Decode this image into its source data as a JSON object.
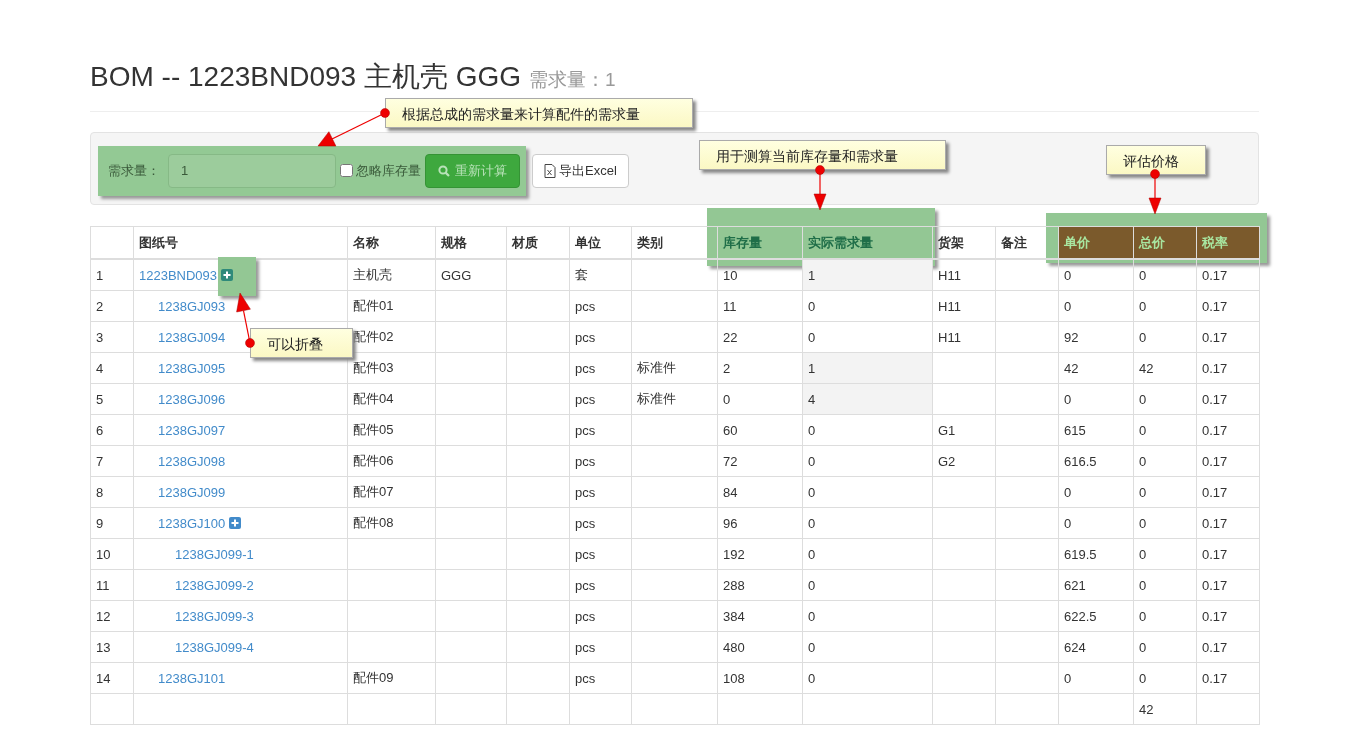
{
  "title": "BOM -- 1223BND093 主机壳 GGG",
  "subtitle": "需求量：1",
  "toolbar": {
    "quantity_label": "需求量：",
    "quantity_value": "1",
    "ignore_stock": {
      "label": "忽略库存量",
      "checked": false
    },
    "recalc_button": "重新计算",
    "export_button": "导出Excel"
  },
  "columns": [
    {
      "label": "图纸号"
    },
    {
      "label": "名称"
    },
    {
      "label": "规格"
    },
    {
      "label": "材质"
    },
    {
      "label": "单位"
    },
    {
      "label": "类别"
    },
    {
      "label": "库存量",
      "kind": "stock"
    },
    {
      "label": "实际需求量",
      "kind": "stock"
    },
    {
      "label": "货架"
    },
    {
      "label": "备注"
    },
    {
      "label": "单价",
      "kind": "price"
    },
    {
      "label": "总价",
      "kind": "price"
    },
    {
      "label": "税率",
      "kind": "price"
    }
  ],
  "rows": [
    {
      "no": "1",
      "drawing_no": "1223BND093",
      "name": "主机壳",
      "spec": "GGG",
      "unit": "套",
      "stock": "10",
      "demand": "1",
      "demand_highlight": true,
      "shelf": "H11",
      "unit_price": "0",
      "total": "0",
      "tax_rate": "0.17",
      "children": [
        {
          "no": "2",
          "drawing_no": "1238GJ093",
          "name": "配件01",
          "unit": "pcs",
          "stock": "11",
          "demand": "0",
          "demand_highlight": false,
          "shelf": "H11",
          "unit_price": "0",
          "total": "0",
          "tax_rate": "0.17"
        },
        {
          "no": "3",
          "drawing_no": "1238GJ094",
          "name": "配件02",
          "unit": "pcs",
          "stock": "22",
          "demand": "0",
          "demand_highlight": false,
          "shelf": "H11",
          "unit_price": "92",
          "total": "0",
          "tax_rate": "0.17"
        },
        {
          "no": "4",
          "drawing_no": "1238GJ095",
          "name": "配件03",
          "unit": "pcs",
          "category": "标准件",
          "stock": "2",
          "demand": "1",
          "demand_highlight": true,
          "unit_price": "42",
          "total": "42",
          "tax_rate": "0.17"
        },
        {
          "no": "5",
          "drawing_no": "1238GJ096",
          "name": "配件04",
          "unit": "pcs",
          "category": "标准件",
          "stock": "0",
          "demand": "4",
          "demand_highlight": true,
          "unit_price": "0",
          "total": "0",
          "tax_rate": "0.17"
        },
        {
          "no": "6",
          "drawing_no": "1238GJ097",
          "name": "配件05",
          "unit": "pcs",
          "stock": "60",
          "demand": "0",
          "demand_highlight": false,
          "shelf": "G1",
          "unit_price": "615",
          "total": "0",
          "tax_rate": "0.17"
        },
        {
          "no": "7",
          "drawing_no": "1238GJ098",
          "name": "配件06",
          "unit": "pcs",
          "stock": "72",
          "demand": "0",
          "demand_highlight": false,
          "shelf": "G2",
          "unit_price": "616.5",
          "total": "0",
          "tax_rate": "0.17"
        },
        {
          "no": "8",
          "drawing_no": "1238GJ099",
          "name": "配件07",
          "unit": "pcs",
          "stock": "84",
          "demand": "0",
          "demand_highlight": false,
          "unit_price": "0",
          "total": "0",
          "tax_rate": "0.17"
        },
        {
          "no": "9",
          "drawing_no": "1238GJ100",
          "name": "配件08",
          "unit": "pcs",
          "stock": "96",
          "demand": "0",
          "demand_highlight": false,
          "unit_price": "0",
          "total": "0",
          "tax_rate": "0.17",
          "children": [
            {
              "no": "10",
              "drawing_no": "1238GJ099-1",
              "unit": "pcs",
              "stock": "192",
              "demand": "0",
              "demand_highlight": false,
              "unit_price": "619.5",
              "total": "0",
              "tax_rate": "0.17"
            },
            {
              "no": "11",
              "drawing_no": "1238GJ099-2",
              "unit": "pcs",
              "stock": "288",
              "demand": "0",
              "demand_highlight": false,
              "unit_price": "621",
              "total": "0",
              "tax_rate": "0.17"
            },
            {
              "no": "12",
              "drawing_no": "1238GJ099-3",
              "unit": "pcs",
              "stock": "384",
              "demand": "0",
              "demand_highlight": false,
              "unit_price": "622.5",
              "total": "0",
              "tax_rate": "0.17"
            },
            {
              "no": "13",
              "drawing_no": "1238GJ099-4",
              "unit": "pcs",
              "stock": "480",
              "demand": "0",
              "demand_highlight": false,
              "unit_price": "624",
              "total": "0",
              "tax_rate": "0.17"
            }
          ]
        },
        {
          "no": "14",
          "drawing_no": "1238GJ101",
          "name": "配件09",
          "unit": "pcs",
          "stock": "108",
          "demand": "0",
          "demand_highlight": false,
          "unit_price": "0",
          "total": "0",
          "tax_rate": "0.17"
        }
      ]
    }
  ],
  "footer": {
    "total": "42"
  },
  "annotations": [
    {
      "text": "根据总成的需求量来计算配件的需求量"
    },
    {
      "text": "用于测算当前库存量和需求量"
    },
    {
      "text": "评估价格"
    },
    {
      "text": "可以折叠"
    }
  ]
}
